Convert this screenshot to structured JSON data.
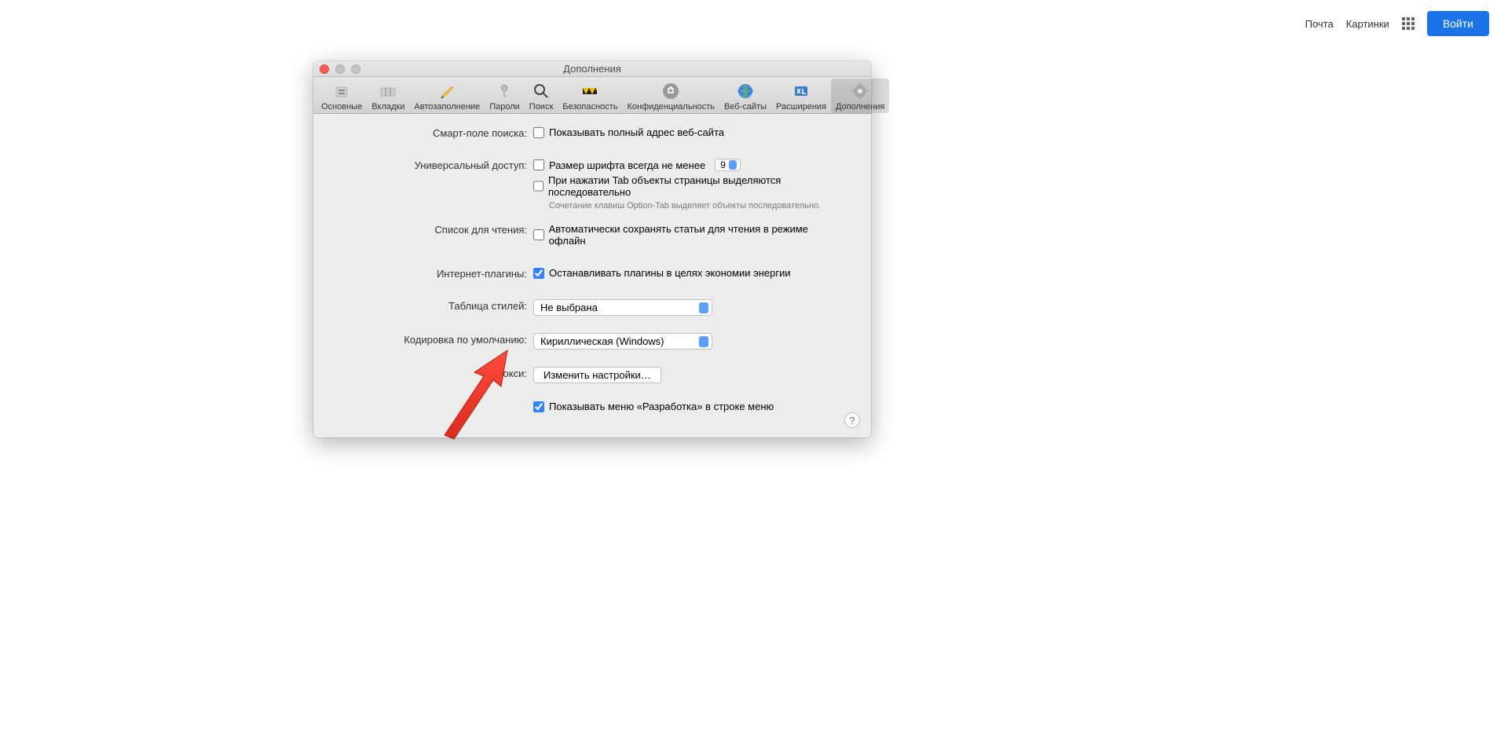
{
  "topnav": {
    "mail": "Почта",
    "images": "Картинки",
    "signin": "Войти"
  },
  "window": {
    "title": "Дополнения"
  },
  "toolbar": [
    {
      "id": "general",
      "label": "Основные"
    },
    {
      "id": "tabs",
      "label": "Вкладки"
    },
    {
      "id": "autofill",
      "label": "Автозаполнение"
    },
    {
      "id": "passwords",
      "label": "Пароли"
    },
    {
      "id": "search",
      "label": "Поиск"
    },
    {
      "id": "security",
      "label": "Безопасность"
    },
    {
      "id": "privacy",
      "label": "Конфиденциальность"
    },
    {
      "id": "websites",
      "label": "Веб-сайты"
    },
    {
      "id": "extensions",
      "label": "Расширения"
    },
    {
      "id": "advanced",
      "label": "Дополнения"
    }
  ],
  "rows": {
    "smartsearch": {
      "label": "Смарт-поле поиска:",
      "cb_full_address": "Показывать полный адрес веб-сайта"
    },
    "accessibility": {
      "label": "Универсальный доступ:",
      "cb_fontsize": "Размер шрифта всегда не менее",
      "fontsize_value": "9",
      "cb_tab": "При нажатии Tab объекты страницы выделяются последовательно",
      "help": "Сочетание клавиш Option-Tab выделяет объекты последовательно."
    },
    "readinglist": {
      "label": "Список для чтения:",
      "cb": "Автоматически сохранять статьи для чтения в режиме офлайн"
    },
    "plugins": {
      "label": "Интернет-плагины:",
      "cb": "Останавливать плагины в целях экономии энергии"
    },
    "stylesheet": {
      "label": "Таблица стилей:",
      "value": "Не выбрана"
    },
    "encoding": {
      "label": "Кодировка по умолчанию:",
      "value": "Кириллическая (Windows)"
    },
    "proxies": {
      "label": "Прокси:",
      "button": "Изменить настройки…"
    },
    "develop": {
      "cb": "Показывать меню «Разработка» в строке меню"
    }
  },
  "help": "?"
}
